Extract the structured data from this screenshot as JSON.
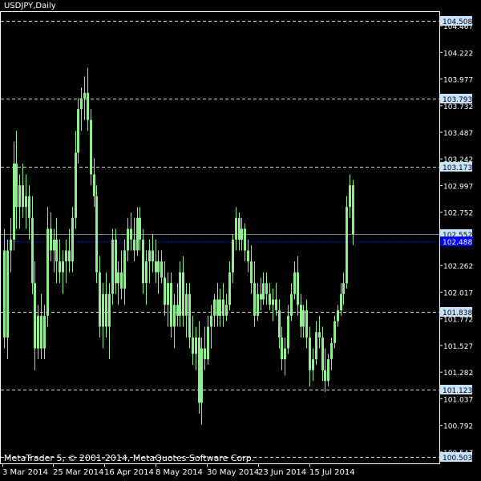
{
  "window_title": "USDJPY,Daily",
  "copyright": "MetaTrader 5, © 2001-2014, MetaQuotes Software Corp.",
  "colors": {
    "background": "#000000",
    "frame": "#ffffff",
    "candles": "#90ee90",
    "levels": "#ffffff",
    "bid_line": "#0000ff",
    "ask_line": "#708090",
    "label_bg": "#c6e2ff",
    "bid_label_bg": "#0000ff"
  },
  "chart_data": {
    "type": "candlestick",
    "symbol": "USDJPY",
    "timeframe": "Daily",
    "ylim": [
      100.443,
      104.6
    ],
    "y_ticks": [
      "104.467",
      "104.222",
      "103.977",
      "103.732",
      "103.487",
      "103.242",
      "102.997",
      "102.752",
      "102.507",
      "102.262",
      "102.017",
      "101.772",
      "101.527",
      "101.282",
      "101.037",
      "100.792",
      "100.547"
    ],
    "x_ticks": [
      "3 Mar 2014",
      "25 Mar 2014",
      "16 Apr 2014",
      "8 May 2014",
      "30 May 2014",
      "23 Jun 2014",
      "15 Jul 2014"
    ],
    "horizontal_levels": [
      "104.508",
      "103.793",
      "103.173",
      "101.838",
      "101.123",
      "100.503"
    ],
    "ask_price": "102.552",
    "bid_price": "102.488",
    "grid": false,
    "bars": [
      {
        "o": 102.4,
        "h": 102.6,
        "l": 101.5,
        "c": 101.6
      },
      {
        "o": 101.6,
        "h": 102.5,
        "l": 101.4,
        "c": 102.4
      },
      {
        "o": 102.4,
        "h": 102.7,
        "l": 102.2,
        "c": 102.5
      },
      {
        "o": 102.5,
        "h": 103.4,
        "l": 102.4,
        "c": 103.2
      },
      {
        "o": 103.2,
        "h": 103.5,
        "l": 102.6,
        "c": 102.8
      },
      {
        "o": 102.8,
        "h": 103.1,
        "l": 102.6,
        "c": 103.0
      },
      {
        "o": 103.0,
        "h": 103.2,
        "l": 102.7,
        "c": 102.8
      },
      {
        "o": 102.8,
        "h": 103.1,
        "l": 102.6,
        "c": 102.9
      },
      {
        "o": 102.9,
        "h": 103.0,
        "l": 102.5,
        "c": 102.7
      },
      {
        "o": 102.7,
        "h": 102.9,
        "l": 102.0,
        "c": 102.1
      },
      {
        "o": 102.1,
        "h": 102.3,
        "l": 101.3,
        "c": 101.5
      },
      {
        "o": 101.5,
        "h": 101.9,
        "l": 101.4,
        "c": 101.8
      },
      {
        "o": 101.8,
        "h": 102.0,
        "l": 101.4,
        "c": 101.5
      },
      {
        "o": 101.5,
        "h": 101.9,
        "l": 101.4,
        "c": 101.8
      },
      {
        "o": 101.8,
        "h": 102.8,
        "l": 101.7,
        "c": 102.6
      },
      {
        "o": 102.6,
        "h": 102.75,
        "l": 102.3,
        "c": 102.4
      },
      {
        "o": 102.4,
        "h": 102.6,
        "l": 102.2,
        "c": 102.5
      },
      {
        "o": 102.5,
        "h": 102.7,
        "l": 102.1,
        "c": 102.3
      },
      {
        "o": 102.3,
        "h": 102.5,
        "l": 102.1,
        "c": 102.2
      },
      {
        "o": 102.2,
        "h": 102.4,
        "l": 102.0,
        "c": 102.3
      },
      {
        "o": 102.3,
        "h": 102.5,
        "l": 102.1,
        "c": 102.4
      },
      {
        "o": 102.4,
        "h": 102.6,
        "l": 102.2,
        "c": 102.3
      },
      {
        "o": 102.3,
        "h": 102.8,
        "l": 102.2,
        "c": 102.7
      },
      {
        "o": 102.7,
        "h": 103.5,
        "l": 102.6,
        "c": 103.3
      },
      {
        "o": 103.3,
        "h": 103.8,
        "l": 103.2,
        "c": 103.7
      },
      {
        "o": 103.7,
        "h": 103.9,
        "l": 103.5,
        "c": 103.8
      },
      {
        "o": 103.8,
        "h": 104.0,
        "l": 103.6,
        "c": 103.85
      },
      {
        "o": 103.85,
        "h": 104.08,
        "l": 103.5,
        "c": 103.6
      },
      {
        "o": 103.6,
        "h": 103.7,
        "l": 103.0,
        "c": 103.1
      },
      {
        "o": 103.1,
        "h": 103.25,
        "l": 102.8,
        "c": 102.9
      },
      {
        "o": 102.9,
        "h": 103.0,
        "l": 102.1,
        "c": 102.2
      },
      {
        "o": 102.2,
        "h": 102.35,
        "l": 101.6,
        "c": 101.7
      },
      {
        "o": 101.7,
        "h": 102.1,
        "l": 101.5,
        "c": 102.0
      },
      {
        "o": 102.0,
        "h": 102.2,
        "l": 101.6,
        "c": 101.7
      },
      {
        "o": 101.7,
        "h": 102.1,
        "l": 101.4,
        "c": 102.0
      },
      {
        "o": 102.0,
        "h": 102.6,
        "l": 101.9,
        "c": 102.5
      },
      {
        "o": 102.5,
        "h": 102.6,
        "l": 102.0,
        "c": 102.1
      },
      {
        "o": 102.1,
        "h": 102.3,
        "l": 101.9,
        "c": 102.2
      },
      {
        "o": 102.2,
        "h": 102.4,
        "l": 101.95,
        "c": 102.05
      },
      {
        "o": 102.05,
        "h": 102.5,
        "l": 101.9,
        "c": 102.4
      },
      {
        "o": 102.4,
        "h": 102.7,
        "l": 102.3,
        "c": 102.6
      },
      {
        "o": 102.6,
        "h": 102.75,
        "l": 102.4,
        "c": 102.5
      },
      {
        "o": 102.5,
        "h": 102.7,
        "l": 102.3,
        "c": 102.4
      },
      {
        "o": 102.4,
        "h": 102.8,
        "l": 102.35,
        "c": 102.7
      },
      {
        "o": 102.7,
        "h": 102.8,
        "l": 102.4,
        "c": 102.5
      },
      {
        "o": 102.5,
        "h": 102.6,
        "l": 102.0,
        "c": 102.1
      },
      {
        "o": 102.1,
        "h": 102.4,
        "l": 101.9,
        "c": 102.3
      },
      {
        "o": 102.3,
        "h": 102.5,
        "l": 102.1,
        "c": 102.4
      },
      {
        "o": 102.4,
        "h": 102.55,
        "l": 102.2,
        "c": 102.3
      },
      {
        "o": 102.3,
        "h": 102.5,
        "l": 102.1,
        "c": 102.2
      },
      {
        "o": 102.2,
        "h": 102.4,
        "l": 102.0,
        "c": 102.3
      },
      {
        "o": 102.3,
        "h": 102.4,
        "l": 102.1,
        "c": 102.15
      },
      {
        "o": 102.15,
        "h": 102.3,
        "l": 101.8,
        "c": 101.9
      },
      {
        "o": 101.9,
        "h": 102.2,
        "l": 101.7,
        "c": 102.1
      },
      {
        "o": 102.1,
        "h": 102.2,
        "l": 101.6,
        "c": 101.7
      },
      {
        "o": 101.7,
        "h": 102.0,
        "l": 101.5,
        "c": 101.9
      },
      {
        "o": 101.9,
        "h": 102.1,
        "l": 101.7,
        "c": 101.8
      },
      {
        "o": 101.8,
        "h": 102.3,
        "l": 101.7,
        "c": 102.2
      },
      {
        "o": 102.2,
        "h": 102.35,
        "l": 101.7,
        "c": 101.8
      },
      {
        "o": 101.8,
        "h": 102.1,
        "l": 101.6,
        "c": 102.0
      },
      {
        "o": 102.0,
        "h": 102.1,
        "l": 101.5,
        "c": 101.6
      },
      {
        "o": 101.6,
        "h": 101.8,
        "l": 101.35,
        "c": 101.45
      },
      {
        "o": 101.45,
        "h": 101.7,
        "l": 101.3,
        "c": 101.6
      },
      {
        "o": 101.6,
        "h": 101.75,
        "l": 100.9,
        "c": 101.0
      },
      {
        "o": 101.0,
        "h": 101.6,
        "l": 100.8,
        "c": 101.5
      },
      {
        "o": 101.5,
        "h": 101.7,
        "l": 101.3,
        "c": 101.4
      },
      {
        "o": 101.4,
        "h": 101.8,
        "l": 101.35,
        "c": 101.7
      },
      {
        "o": 101.7,
        "h": 101.9,
        "l": 101.5,
        "c": 101.8
      },
      {
        "o": 101.8,
        "h": 102.0,
        "l": 101.7,
        "c": 101.95
      },
      {
        "o": 101.95,
        "h": 102.1,
        "l": 101.7,
        "c": 101.8
      },
      {
        "o": 101.8,
        "h": 102.05,
        "l": 101.7,
        "c": 101.95
      },
      {
        "o": 101.95,
        "h": 102.1,
        "l": 101.7,
        "c": 101.8
      },
      {
        "o": 101.8,
        "h": 102.0,
        "l": 101.75,
        "c": 101.9
      },
      {
        "o": 101.9,
        "h": 102.3,
        "l": 101.85,
        "c": 102.2
      },
      {
        "o": 102.2,
        "h": 102.55,
        "l": 102.1,
        "c": 102.5
      },
      {
        "o": 102.5,
        "h": 102.8,
        "l": 102.4,
        "c": 102.7
      },
      {
        "o": 102.7,
        "h": 102.75,
        "l": 102.4,
        "c": 102.5
      },
      {
        "o": 102.5,
        "h": 102.7,
        "l": 102.4,
        "c": 102.6
      },
      {
        "o": 102.6,
        "h": 102.65,
        "l": 102.3,
        "c": 102.4
      },
      {
        "o": 102.4,
        "h": 102.5,
        "l": 102.2,
        "c": 102.3
      },
      {
        "o": 102.3,
        "h": 102.45,
        "l": 102.0,
        "c": 102.1
      },
      {
        "o": 102.1,
        "h": 102.3,
        "l": 101.7,
        "c": 101.8
      },
      {
        "o": 101.8,
        "h": 102.1,
        "l": 101.75,
        "c": 102.0
      },
      {
        "o": 102.0,
        "h": 102.15,
        "l": 101.85,
        "c": 101.95
      },
      {
        "o": 101.95,
        "h": 102.2,
        "l": 101.9,
        "c": 102.1
      },
      {
        "o": 102.1,
        "h": 102.2,
        "l": 101.9,
        "c": 102.0
      },
      {
        "o": 102.0,
        "h": 102.1,
        "l": 101.85,
        "c": 101.9
      },
      {
        "o": 101.9,
        "h": 102.05,
        "l": 101.75,
        "c": 101.95
      },
      {
        "o": 101.95,
        "h": 102.1,
        "l": 101.8,
        "c": 101.85
      },
      {
        "o": 101.85,
        "h": 101.95,
        "l": 101.5,
        "c": 101.6
      },
      {
        "o": 101.6,
        "h": 101.7,
        "l": 101.3,
        "c": 101.4
      },
      {
        "o": 101.4,
        "h": 101.6,
        "l": 101.25,
        "c": 101.5
      },
      {
        "o": 101.5,
        "h": 101.9,
        "l": 101.45,
        "c": 101.8
      },
      {
        "o": 101.8,
        "h": 102.1,
        "l": 101.75,
        "c": 102.0
      },
      {
        "o": 102.0,
        "h": 102.3,
        "l": 101.95,
        "c": 102.2
      },
      {
        "o": 102.2,
        "h": 102.35,
        "l": 101.8,
        "c": 101.9
      },
      {
        "o": 101.9,
        "h": 102.0,
        "l": 101.6,
        "c": 101.7
      },
      {
        "o": 101.7,
        "h": 101.9,
        "l": 101.6,
        "c": 101.85
      },
      {
        "o": 101.85,
        "h": 101.95,
        "l": 101.5,
        "c": 101.6
      },
      {
        "o": 101.6,
        "h": 101.7,
        "l": 101.15,
        "c": 101.3
      },
      {
        "o": 101.3,
        "h": 101.5,
        "l": 101.2,
        "c": 101.4
      },
      {
        "o": 101.4,
        "h": 101.75,
        "l": 101.35,
        "c": 101.65
      },
      {
        "o": 101.65,
        "h": 101.8,
        "l": 101.5,
        "c": 101.6
      },
      {
        "o": 101.6,
        "h": 101.7,
        "l": 101.2,
        "c": 101.3
      },
      {
        "o": 101.3,
        "h": 101.5,
        "l": 101.1,
        "c": 101.2
      },
      {
        "o": 101.2,
        "h": 101.45,
        "l": 101.15,
        "c": 101.4
      },
      {
        "o": 101.4,
        "h": 101.6,
        "l": 101.3,
        "c": 101.55
      },
      {
        "o": 101.55,
        "h": 101.8,
        "l": 101.5,
        "c": 101.75
      },
      {
        "o": 101.75,
        "h": 101.9,
        "l": 101.7,
        "c": 101.85
      },
      {
        "o": 101.85,
        "h": 102.1,
        "l": 101.8,
        "c": 102.0
      },
      {
        "o": 102.0,
        "h": 102.2,
        "l": 101.9,
        "c": 102.1
      },
      {
        "o": 102.1,
        "h": 102.9,
        "l": 102.05,
        "c": 102.8
      },
      {
        "o": 102.8,
        "h": 103.1,
        "l": 102.7,
        "c": 103.0
      },
      {
        "o": 103.0,
        "h": 103.05,
        "l": 102.45,
        "c": 102.55
      }
    ]
  }
}
